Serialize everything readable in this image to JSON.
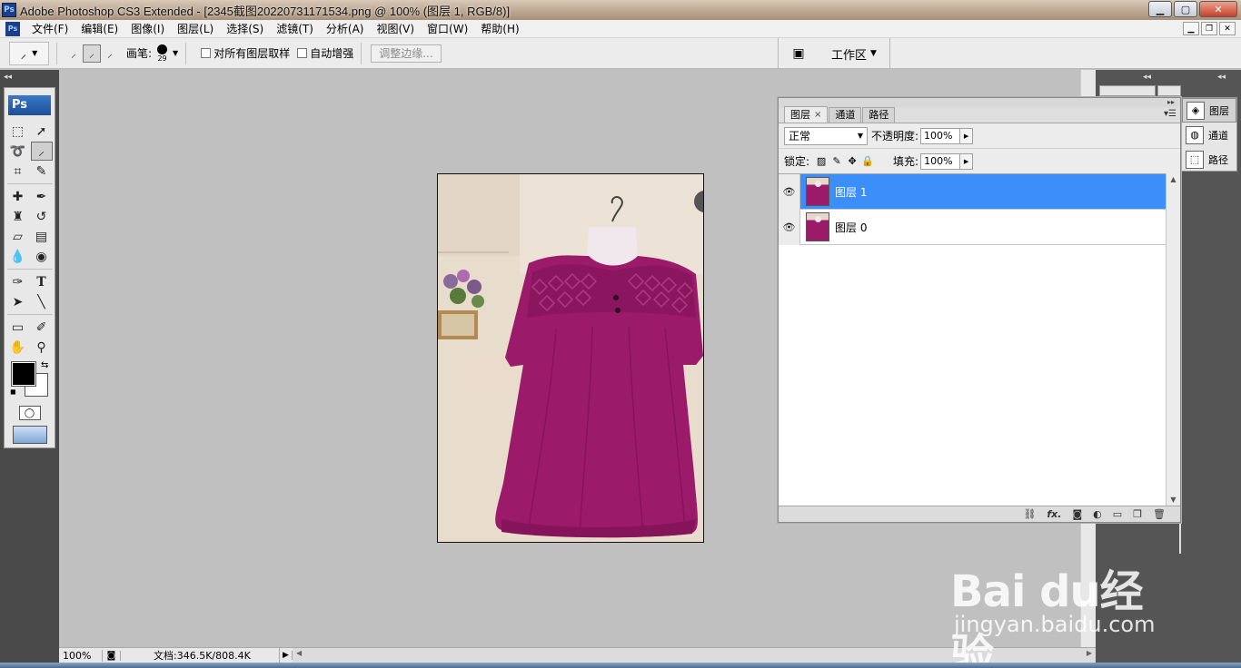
{
  "window": {
    "title": "Adobe Photoshop CS3 Extended - [2345截图20220731171534.png @ 100% (图层 1, RGB/8)]",
    "app_icon": "Ps",
    "min_label": "▁",
    "max_label": "▢",
    "close_label": "✕"
  },
  "menu": {
    "items": [
      "文件(F)",
      "编辑(E)",
      "图像(I)",
      "图层(L)",
      "选择(S)",
      "滤镜(T)",
      "分析(A)",
      "视图(V)",
      "窗口(W)",
      "帮助(H)"
    ],
    "doc_min": "▁",
    "doc_restore": "❐",
    "doc_close": "✕"
  },
  "options": {
    "brush_label": "画笔:",
    "brush_size": "29",
    "sample_all_label": "对所有图层取样",
    "auto_enhance_label": "自动增强",
    "refine_edge_label": "调整边缘...",
    "workspace_label": "工作区",
    "workspace_arrow": "▼"
  },
  "tools": {
    "ps_label": "Ps",
    "swap": "⇆",
    "default": "◼"
  },
  "status": {
    "zoom": "100%",
    "doc_size": "文档:346.5K/808.4K",
    "arrow": "▶",
    "hscroll_left": "◀",
    "hscroll_right": "▶"
  },
  "layers_panel": {
    "tabs": [
      {
        "label": "图层",
        "active": true,
        "close": "×"
      },
      {
        "label": "通道",
        "active": false
      },
      {
        "label": "路径",
        "active": false
      }
    ],
    "blend_mode": "正常",
    "opacity_label": "不透明度:",
    "opacity_value": "100%",
    "lock_label": "锁定:",
    "fill_label": "填充:",
    "fill_value": "100%",
    "layers": [
      {
        "name": "图层 1",
        "selected": true
      },
      {
        "name": "图层 0",
        "selected": false
      }
    ],
    "bottom_icons": [
      "link-icon",
      "fx-icon",
      "mask-icon",
      "adjustment-icon",
      "group-icon",
      "new-layer-icon",
      "trash-icon"
    ],
    "fx_label": "fx."
  },
  "dock": {
    "items": [
      {
        "label": "图层",
        "icon": "layers-icon",
        "active": true
      },
      {
        "label": "通道",
        "icon": "channels-icon",
        "active": false
      },
      {
        "label": "路径",
        "icon": "paths-icon",
        "active": false
      }
    ],
    "collapse": "◂◂",
    "expand": "◂◂"
  },
  "watermark": {
    "logo": "Bai du经验",
    "sub": "jingyan.baidu.com"
  },
  "colors": {
    "selection_blue": "#3c8ef8",
    "garment": "#9c1a6a",
    "panel_bg": "#ececec",
    "workspace_gray": "#c0c0c0"
  }
}
